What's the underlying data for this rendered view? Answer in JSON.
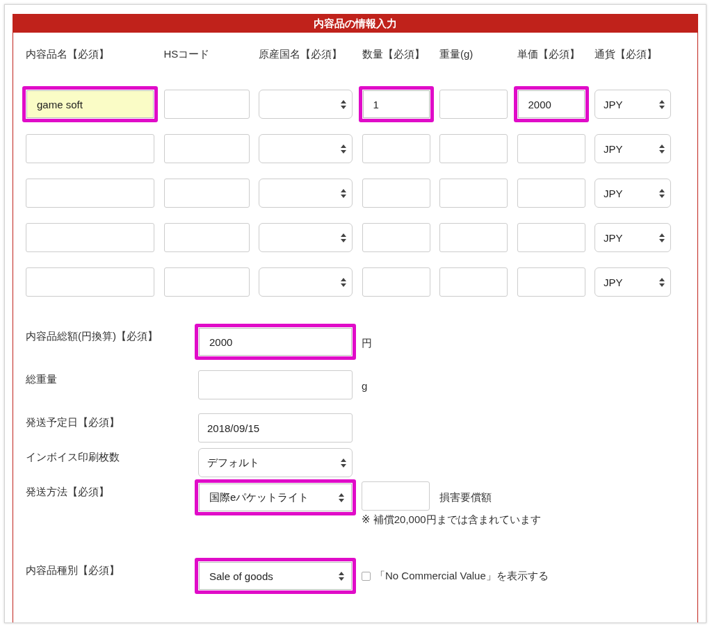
{
  "panel": {
    "title": "内容品の情報入力"
  },
  "items": {
    "columns": [
      {
        "label": "内容品名【必須】"
      },
      {
        "label": "HSコード"
      },
      {
        "label": "原産国名【必須】"
      },
      {
        "label": "数量【必須】"
      },
      {
        "label": "重量(g)"
      },
      {
        "label": "単価【必須】"
      },
      {
        "label": "通貨【必須】"
      }
    ],
    "rows": [
      {
        "cells": [
          {
            "kind": "text",
            "value": "game soft",
            "highlighted": true,
            "autofilled": true
          },
          {
            "kind": "text",
            "highlighted": false,
            "autofilled": false
          },
          {
            "kind": "select",
            "highlighted": false,
            "autofilled": false
          },
          {
            "kind": "text",
            "value": "1",
            "highlighted": true,
            "autofilled": false
          },
          {
            "kind": "text",
            "highlighted": false,
            "autofilled": false
          },
          {
            "kind": "text",
            "value": "2000",
            "highlighted": true,
            "autofilled": false
          },
          {
            "kind": "select",
            "value": "JPY",
            "highlighted": false,
            "autofilled": false
          }
        ]
      },
      {
        "cells": [
          {
            "kind": "text",
            "highlighted": false,
            "autofilled": false
          },
          {
            "kind": "text",
            "highlighted": false,
            "autofilled": false
          },
          {
            "kind": "select",
            "highlighted": false,
            "autofilled": false
          },
          {
            "kind": "text",
            "highlighted": false,
            "autofilled": false
          },
          {
            "kind": "text",
            "highlighted": false,
            "autofilled": false
          },
          {
            "kind": "text",
            "highlighted": false,
            "autofilled": false
          },
          {
            "kind": "select",
            "value": "JPY",
            "highlighted": false,
            "autofilled": false
          }
        ]
      },
      {
        "cells": [
          {
            "kind": "text",
            "highlighted": false,
            "autofilled": false
          },
          {
            "kind": "text",
            "highlighted": false,
            "autofilled": false
          },
          {
            "kind": "select",
            "highlighted": false,
            "autofilled": false
          },
          {
            "kind": "text",
            "highlighted": false,
            "autofilled": false
          },
          {
            "kind": "text",
            "highlighted": false,
            "autofilled": false
          },
          {
            "kind": "text",
            "highlighted": false,
            "autofilled": false
          },
          {
            "kind": "select",
            "value": "JPY",
            "highlighted": false,
            "autofilled": false
          }
        ]
      },
      {
        "cells": [
          {
            "kind": "text",
            "highlighted": false,
            "autofilled": false
          },
          {
            "kind": "text",
            "highlighted": false,
            "autofilled": false
          },
          {
            "kind": "select",
            "highlighted": false,
            "autofilled": false
          },
          {
            "kind": "text",
            "highlighted": false,
            "autofilled": false
          },
          {
            "kind": "text",
            "highlighted": false,
            "autofilled": false
          },
          {
            "kind": "text",
            "highlighted": false,
            "autofilled": false
          },
          {
            "kind": "select",
            "value": "JPY",
            "highlighted": false,
            "autofilled": false
          }
        ]
      },
      {
        "cells": [
          {
            "kind": "text",
            "highlighted": false,
            "autofilled": false
          },
          {
            "kind": "text",
            "highlighted": false,
            "autofilled": false
          },
          {
            "kind": "select",
            "highlighted": false,
            "autofilled": false
          },
          {
            "kind": "text",
            "highlighted": false,
            "autofilled": false
          },
          {
            "kind": "text",
            "highlighted": false,
            "autofilled": false
          },
          {
            "kind": "text",
            "highlighted": false,
            "autofilled": false
          },
          {
            "kind": "select",
            "value": "JPY",
            "highlighted": false,
            "autofilled": false
          }
        ]
      }
    ]
  },
  "summary": [
    {
      "label": "内容品総額(円換算)【必須】",
      "control": {
        "kind": "text",
        "value": "2000",
        "highlighted": true
      },
      "suffix": "円"
    },
    {
      "label": "総重量",
      "control": {
        "kind": "text",
        "highlighted": false
      },
      "suffix": "g"
    },
    {
      "label": "発送予定日【必須】",
      "control": {
        "kind": "text",
        "value": "2018/09/15",
        "highlighted": false
      }
    },
    {
      "label": "インボイス印刷枚数",
      "control": {
        "kind": "select",
        "value": "デフォルト",
        "highlighted": false
      }
    },
    {
      "label": "発送方法【必須】",
      "control": {
        "kind": "select",
        "value": "国際eパケットライト",
        "highlighted": true
      },
      "insurance": {
        "label": "損害要償額",
        "note": "※ 補償20,000円までは含まれています"
      }
    },
    {
      "label": "内容品種別【必須】",
      "control": {
        "kind": "select",
        "value": "Sale of goods",
        "highlighted": true
      },
      "checkbox": {
        "label": "「No Commercial Value」を表示する",
        "checked": false
      }
    }
  ]
}
